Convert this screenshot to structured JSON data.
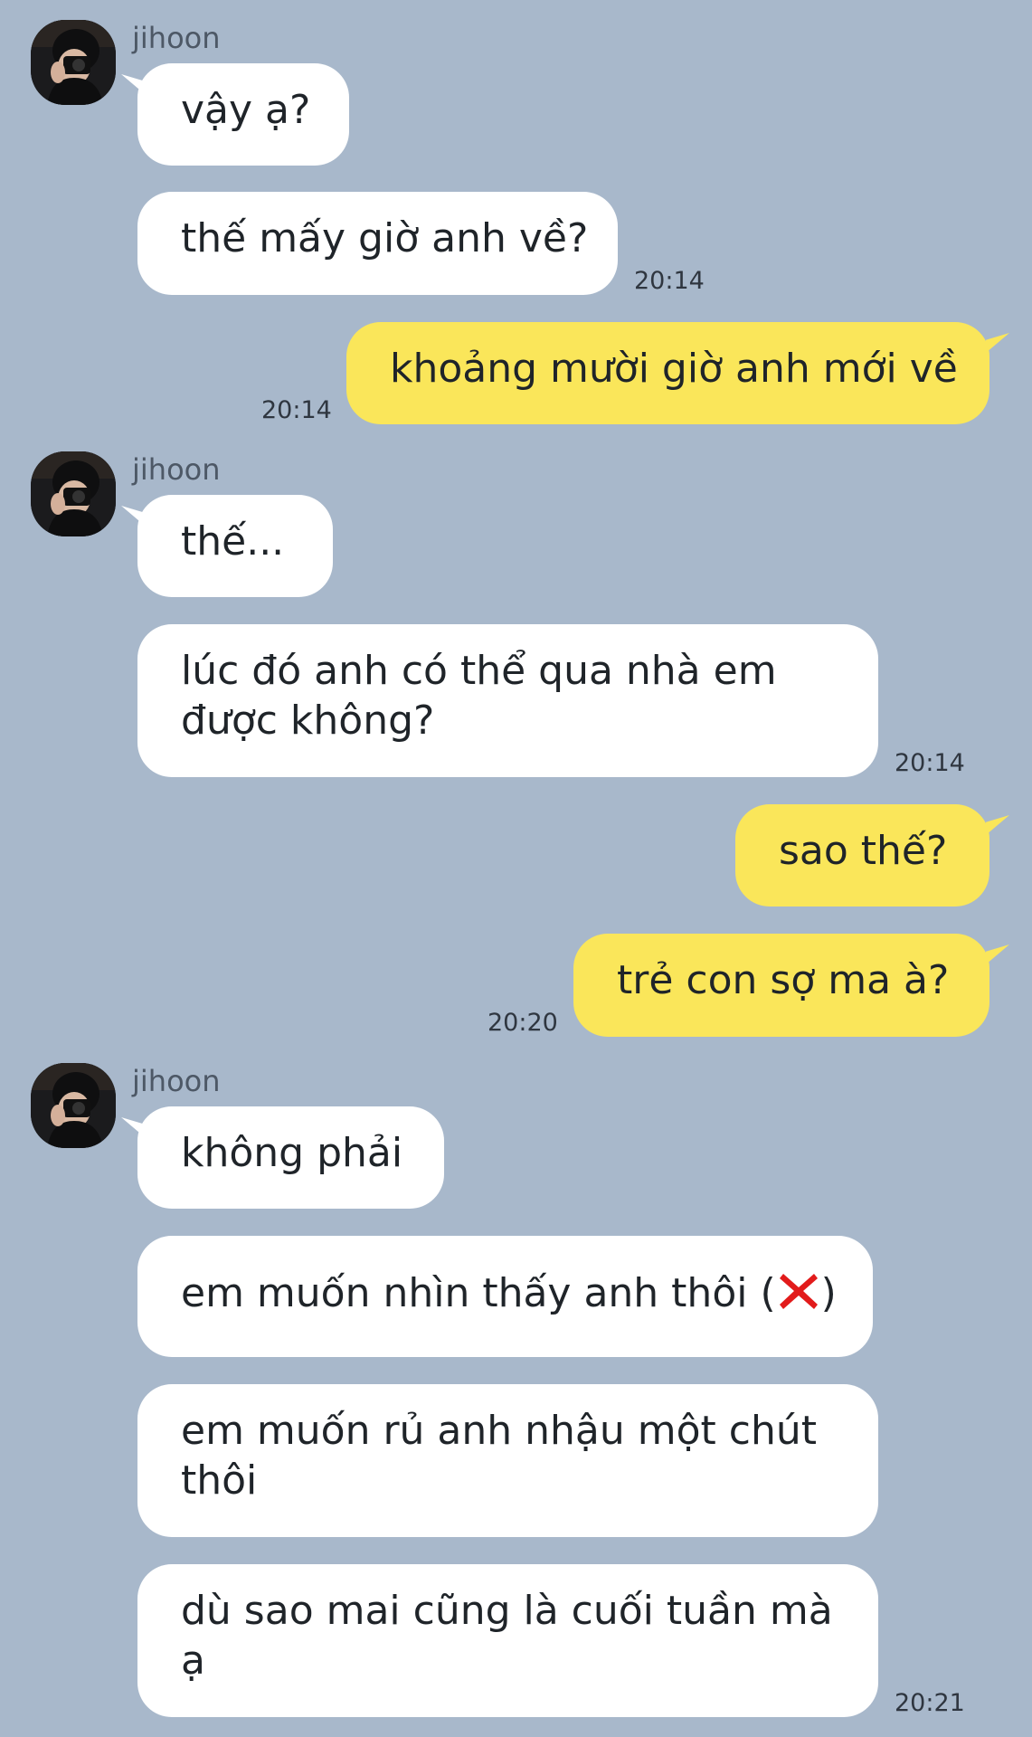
{
  "contact": {
    "name": "jihoon",
    "avatar_icon": "person-with-camera-avatar"
  },
  "colors": {
    "background": "#a8b8cb",
    "incoming_bubble": "#ffffff",
    "outgoing_bubble": "#fae65a",
    "text": "#1f2429",
    "name_text": "#4d5866"
  },
  "messages": [
    {
      "dir": "in",
      "text": "vậy ạ?"
    },
    {
      "dir": "in",
      "text": "thế mấy giờ anh về?",
      "time": "20:14"
    },
    {
      "dir": "out",
      "text": "khoảng mười giờ anh mới về",
      "time": "20:14"
    },
    {
      "dir": "in",
      "text": "thế..."
    },
    {
      "dir": "in",
      "text_lines": [
        "lúc đó anh có thể qua nhà em",
        "được không?"
      ],
      "time": "20:14"
    },
    {
      "dir": "out",
      "text": "sao thế?"
    },
    {
      "dir": "out",
      "text": "trẻ con sợ ma à?",
      "time": "20:20"
    },
    {
      "dir": "in",
      "text": "không phải"
    },
    {
      "dir": "in",
      "text_before": "em muốn nhìn thấy anh thôi (",
      "emoji": "red-cross-mark-icon",
      "text_after": ")"
    },
    {
      "dir": "in",
      "text_lines": [
        "em muốn rủ anh nhậu một chút",
        "thôi"
      ]
    },
    {
      "dir": "in",
      "text_lines": [
        "dù sao mai cũng là cuối tuần mà",
        "ạ"
      ],
      "time": "20:21"
    }
  ]
}
